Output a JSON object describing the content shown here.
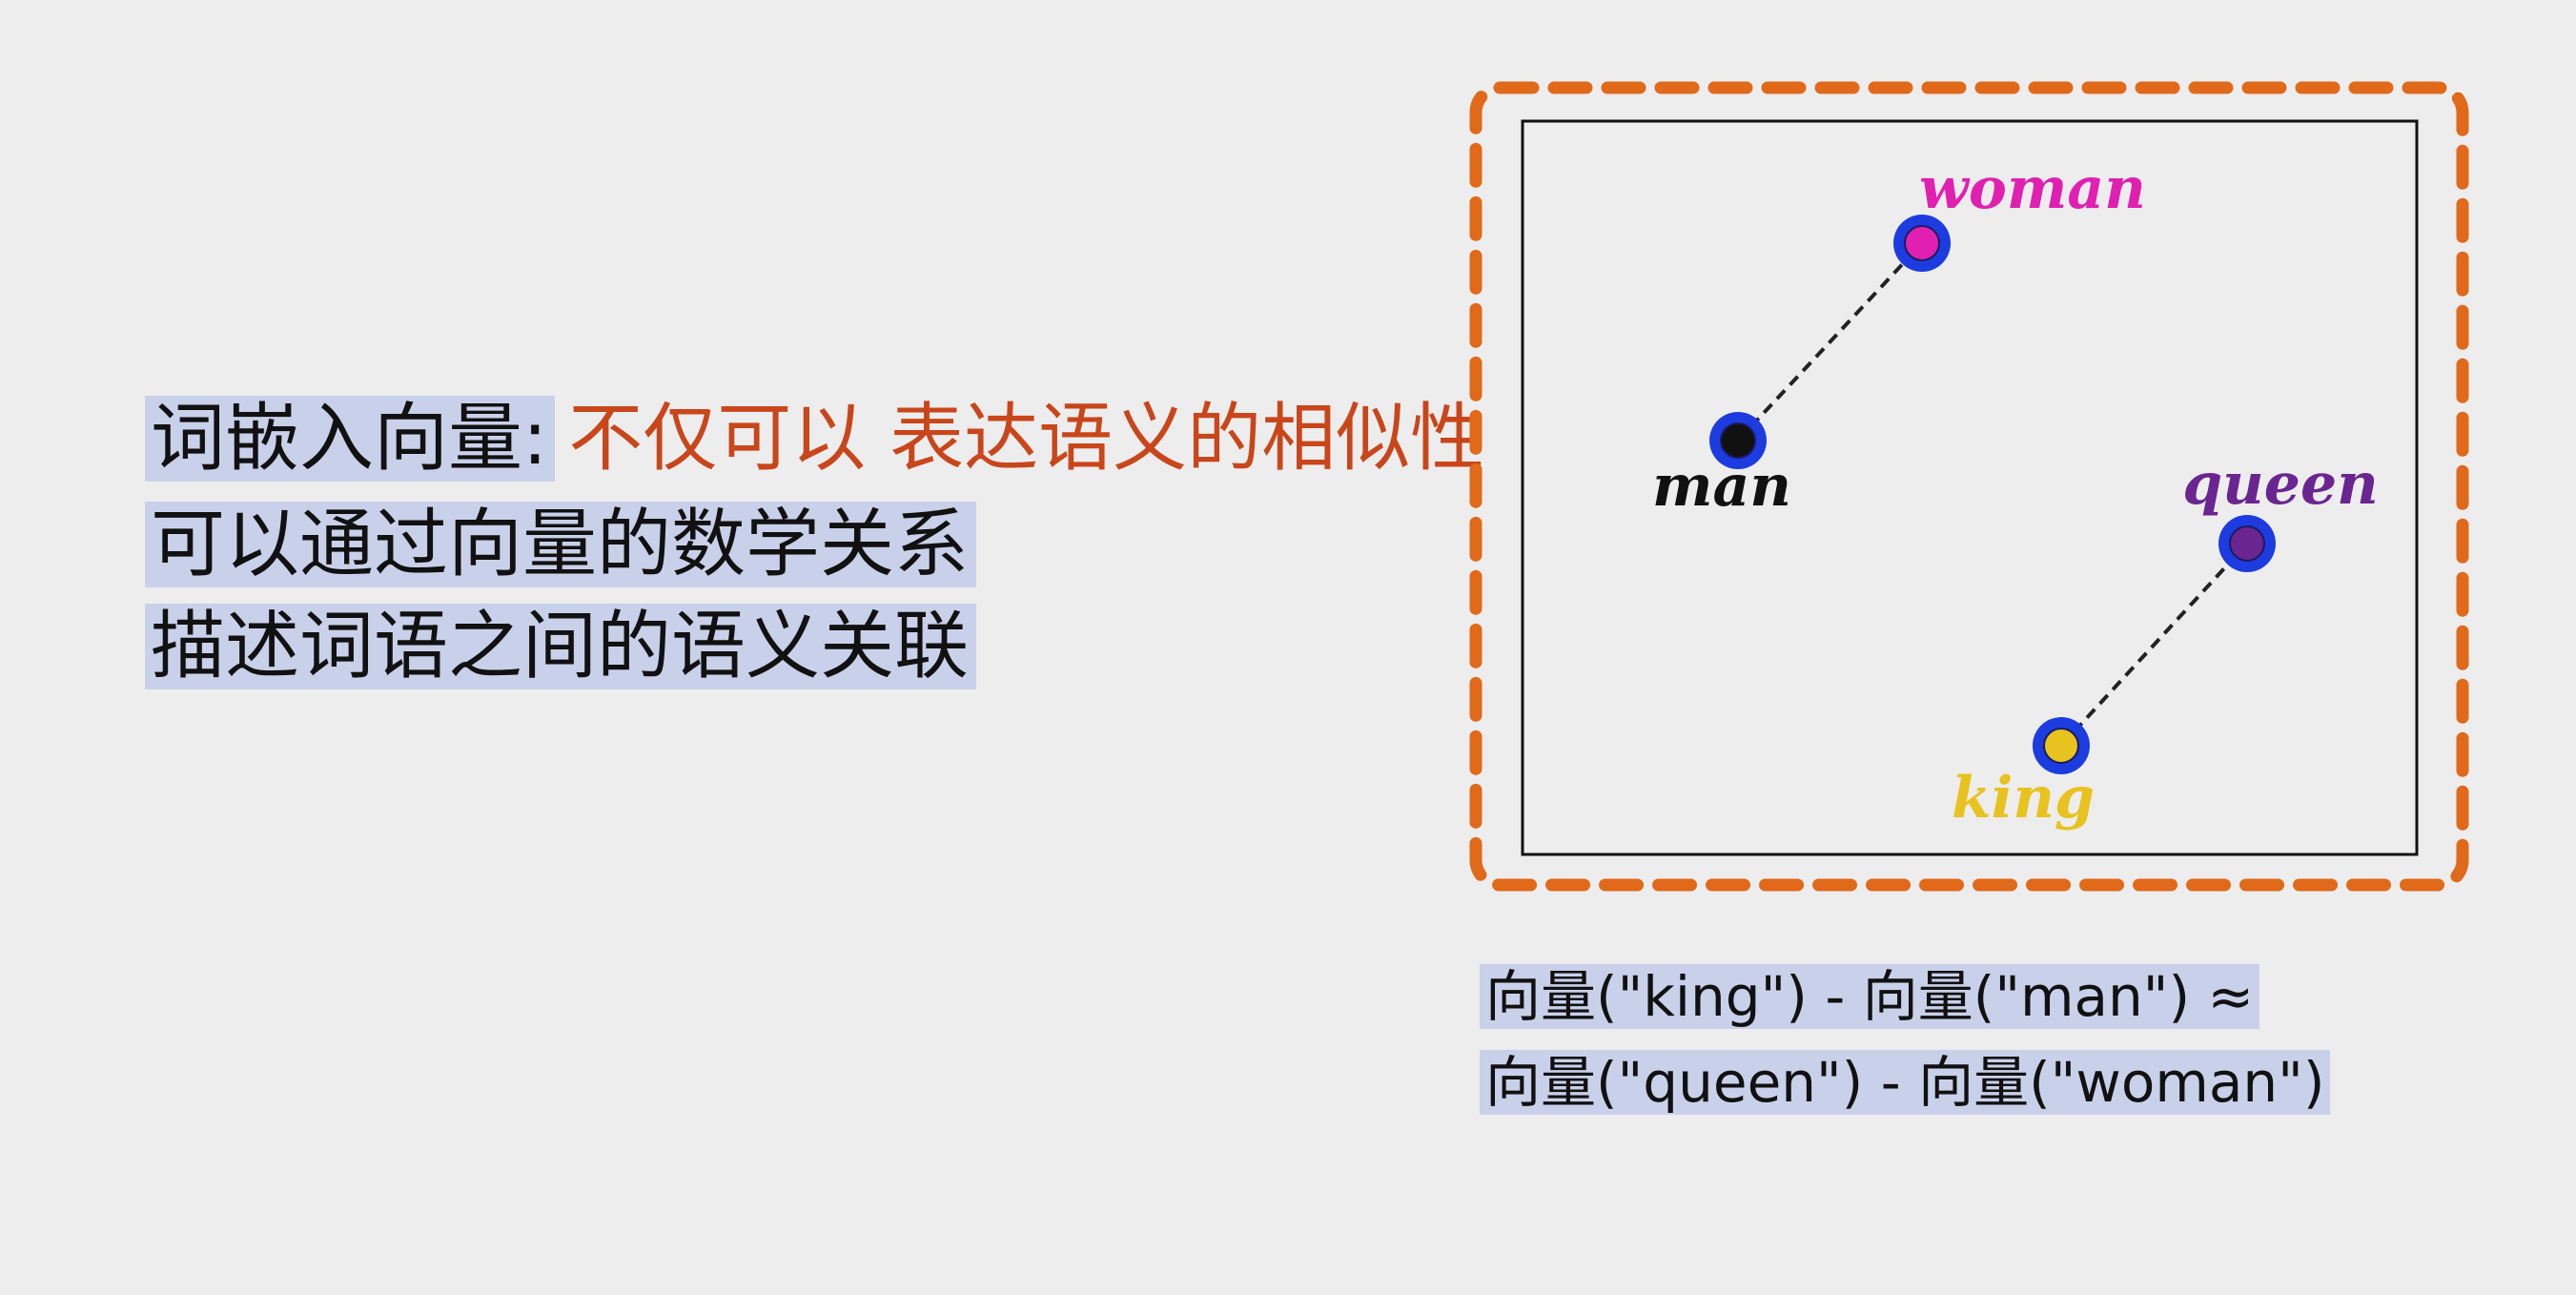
{
  "text": {
    "line1_label": "词嵌入向量:",
    "line1_accent": "不仅可以 表达语义的相似性",
    "line2": "可以通过向量的数学关系",
    "line3": "描述词语之间的语义关联"
  },
  "formula": {
    "line1": "向量(\"king\") - 向量(\"man\") ≈",
    "line2": "向量(\"queen\") - 向量(\"woman\")"
  },
  "diagram": {
    "points": [
      {
        "word": "woman",
        "color": "#e020b0"
      },
      {
        "word": "man",
        "color": "#111111"
      },
      {
        "word": "queen",
        "color": "#6a2590"
      },
      {
        "word": "king",
        "color": "#e8c21e"
      }
    ],
    "pairs": [
      [
        "man",
        "woman"
      ],
      [
        "king",
        "queen"
      ]
    ],
    "ring_color": "#1c3ce0",
    "frame_color": "#e0691a"
  }
}
